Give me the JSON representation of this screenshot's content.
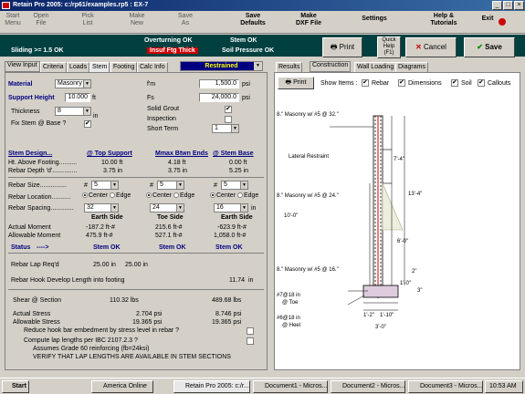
{
  "window": {
    "title": "Retain Pro 2005: c:/rp61/examples.rp5 : EX-7"
  },
  "toolbar": {
    "start_menu": "Start\nMenu",
    "open_file": "Open\nFile",
    "pick_list": "Pick\nList",
    "make_new": "Make\nNew",
    "save_as": "Save\nAs",
    "save_defaults": "Save\nDefaults",
    "make_dxf": "Make\nDXF File",
    "settings": "Settings",
    "help": "Help &\nTutorials",
    "exit": "Exit"
  },
  "status": {
    "sliding": "Sliding >= 1.5 OK",
    "overturning": "Overturning OK",
    "insuf_ftg": "Insuf Ftg Thick",
    "stem": "Stem OK",
    "soil": "Soil Pressure OK"
  },
  "actions": {
    "print": "Print",
    "quick_help": "Quick\nHelp\n(F1)",
    "cancel": "Cancel",
    "save": "Save"
  },
  "left_tabs": [
    "View Input",
    "Criteria",
    "Loads",
    "Stem",
    "Footing",
    "Calc Info"
  ],
  "restrained": "Restrained",
  "right_tabs": [
    "Results",
    "Construction",
    "Wall Loading",
    "Diagrams"
  ],
  "right_toolbar": {
    "print": "Print",
    "show_items": "Show Items :",
    "rebar": "Rebar",
    "dimensions": "Dimensions",
    "soil": "Soil",
    "callouts": "Callouts"
  },
  "material": {
    "label": "Material",
    "value": "Masonry",
    "fm_label": "f'm",
    "fm_value": "1,500.0",
    "fm_unit": "psi"
  },
  "support": {
    "label": "Support Height",
    "value": "10.000",
    "unit": "ft",
    "fs_label": "Fs",
    "fs_value": "24,000.0",
    "fs_unit": "psi"
  },
  "thickness": {
    "label": "Thickness",
    "value": "8",
    "unit": "in",
    "solid_grout": "Solid Grout",
    "inspection": "Inspection"
  },
  "fix_stem": {
    "label": "Fix Stem @ Base ?",
    "short_term": "Short Term",
    "short_term_value": "1"
  },
  "stem_design": {
    "header": "Stem Design...",
    "col1": "@ Top Support",
    "col2": "Mmax Btwn Ends",
    "col3": "@ Stem Base",
    "ht_label": "Ht. Above Footing..........",
    "ht": [
      "10.00 ft",
      "4.18 ft",
      "0.00 ft"
    ],
    "depth_label": "Rebar Depth 'd'..............",
    "depth": [
      "3.75 in",
      "3.75 in",
      "5.25 in"
    ]
  },
  "rebar": {
    "size_label": "Rebar Size...............",
    "sizes": [
      "5",
      "5",
      "5"
    ],
    "location_label": "Rebar Location...........",
    "center": "Center",
    "edge": "Edge",
    "spacing_label": "Rebar Spacing.............",
    "spacings": [
      "32",
      "24",
      "16"
    ],
    "spacing_unit": "in",
    "side_labels": [
      "Earth Side",
      "Toe Side",
      "Earth Side"
    ],
    "actual_label": "Actual Moment",
    "actual": [
      "-187.2 ft-#",
      "215.6 ft-#",
      "-623.9 ft-#"
    ],
    "allow_label": "Allowable Moment",
    "allow": [
      "475.9 ft-#",
      "527.1 ft-#",
      "1,058.0 ft-#"
    ],
    "status_label": "Status",
    "status_arrow": "---->",
    "statuses": [
      "Stem OK",
      "Stem OK",
      "Stem OK"
    ]
  },
  "lap": {
    "label": "Rebar Lap Req'd",
    "val1": "25.00 in",
    "val2": "25.00 in",
    "hook_label": "Rebar Hook Develop Length into footing",
    "hook_val": "11.74",
    "hook_unit": "in"
  },
  "shear": {
    "label": "Shear @ Section",
    "val1": "110.32 lbs",
    "val2": "489.68 lbs"
  },
  "stress": {
    "actual_label": "Actual Stress",
    "actual1": "2.704 psi",
    "actual2": "8.746 psi",
    "allow_label": "Allowable Stress",
    "allow1": "19.365 psi",
    "allow2": "19.365 psi"
  },
  "notes": {
    "reduce": "Reduce hook bar embedment by stress level in rebar ?",
    "compute": "Compute lap lengths per IBC 2107.2.3 ?",
    "assumes": "Assumes Grade 60 reinforcing (fb=24ksi)",
    "verify": "VERIFY THAT LAP LENGTHS ARE AVAILABLE IN STEM SECTIONS"
  },
  "drawing": {
    "c1": "8.\" Masonry w/ #5 @ 32.\"",
    "c2": "8.\" Masonry w/ #5 @ 24.\"",
    "c3": "8.\" Masonry w/ #5 @ 16.\"",
    "lateral": "Lateral Restraint",
    "d1": "7'-4\"",
    "d2": "13'-4\"",
    "d3": "10'-0\"",
    "d4": "6'-0\"",
    "d5": "2\"",
    "d6": "1'-0\"",
    "d7": "3\"",
    "toe1": "#7@18 in",
    "toe2": "@ Toe",
    "heel1": "#6@18 in",
    "heel2": "@ Heel",
    "w1": "1'-2\"",
    "w2": "1'-10\"",
    "w3": "3'-0\""
  },
  "taskbar": {
    "start": "Start",
    "tasks": [
      "America Online",
      "Retain Pro 2005: c:/r...",
      "Document1 - Micros...",
      "Document2 - Micros...",
      "Document3 - Micros..."
    ],
    "time": "10:53 AM"
  }
}
